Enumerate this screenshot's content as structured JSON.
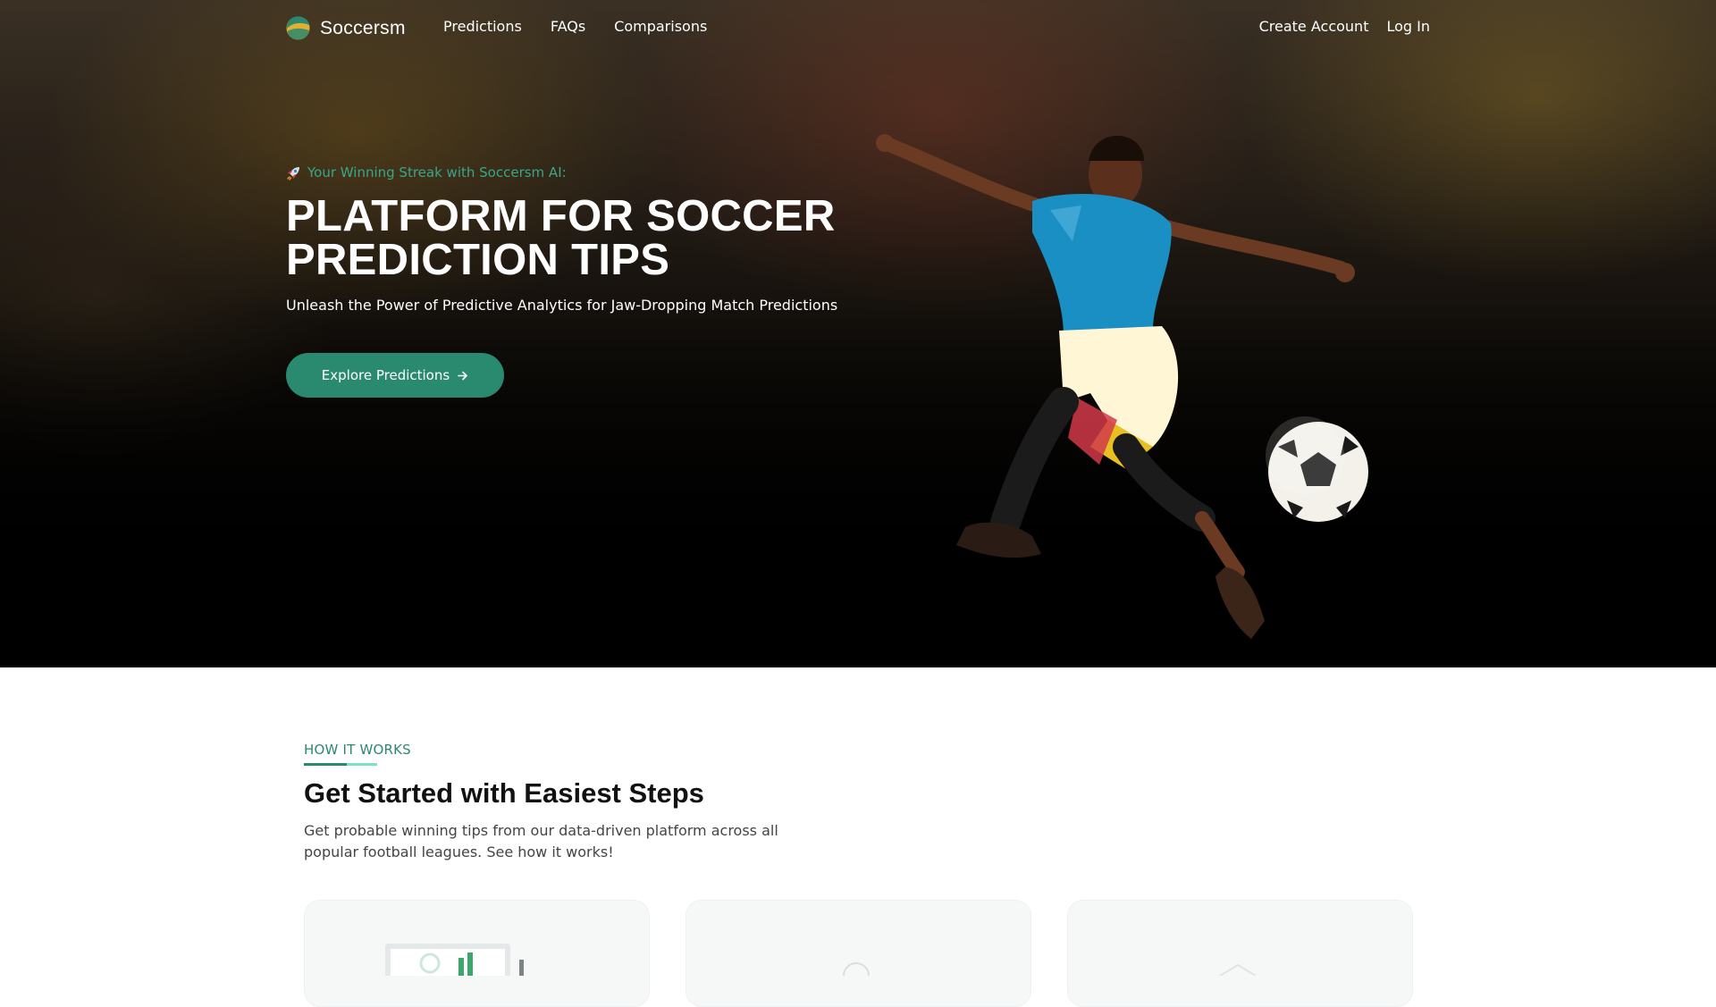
{
  "brand": {
    "name": "Soccersm",
    "accent": "#2a8a70",
    "accent_light": "#7fe0c6"
  },
  "nav": {
    "links": [
      "Predictions",
      "FAQs",
      "Comparisons"
    ],
    "create_account": "Create Account",
    "login": "Log In"
  },
  "hero": {
    "eyebrow_icon": "rocket-icon",
    "eyebrow": "Your Winning Streak with Soccersm AI:",
    "headline_line1": "PLATFORM FOR SOCCER",
    "headline_line2": "PREDICTION TIPS",
    "subheadline": "Unleash the Power of Predictive Analytics for Jaw-Dropping Match Predictions",
    "cta_label": "Explore Predictions",
    "cta_icon": "arrow-right-icon"
  },
  "how_it_works": {
    "label": "HOW IT WORKS",
    "title": "Get Started with Easiest Steps",
    "description": "Get probable winning tips from our data-driven platform across all popular football leagues. See how it works!"
  }
}
